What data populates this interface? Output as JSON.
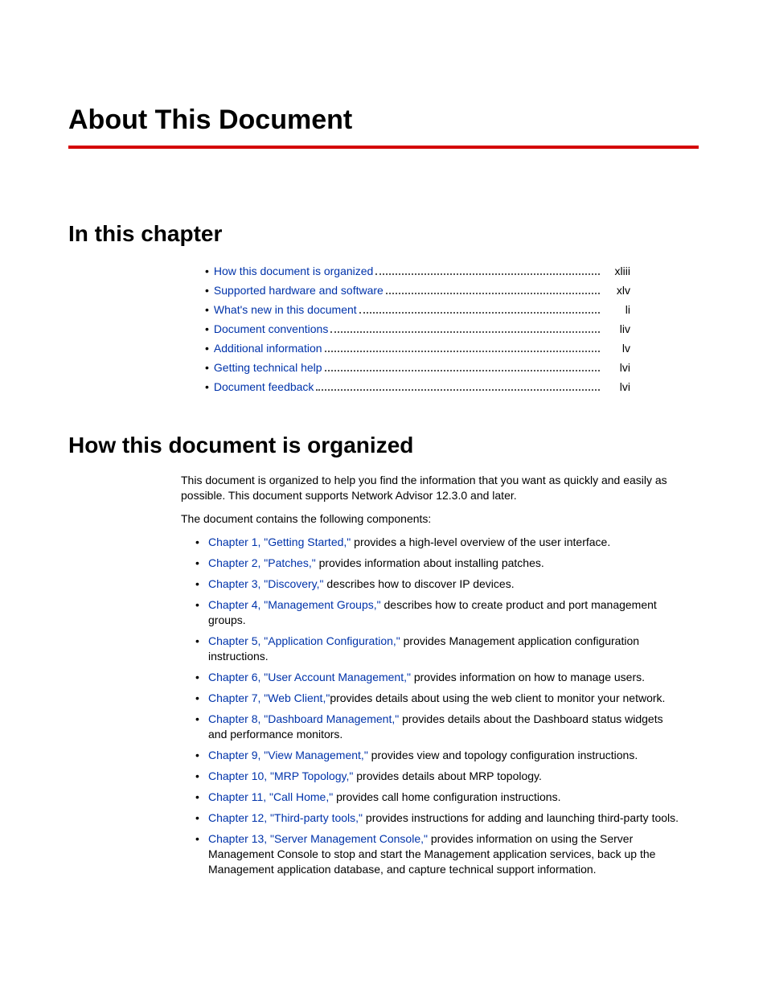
{
  "title": "About This Document",
  "sections": {
    "in_this_chapter": "In this chapter",
    "how_organized": "How this document is organized"
  },
  "toc": [
    {
      "label": "How this document is organized",
      "page": "xliii"
    },
    {
      "label": "Supported hardware and software",
      "page": "xlv"
    },
    {
      "label": "What's new in this document",
      "page": "li"
    },
    {
      "label": "Document conventions",
      "page": "liv"
    },
    {
      "label": "Additional information",
      "page": "lv"
    },
    {
      "label": "Getting technical help",
      "page": "lvi"
    },
    {
      "label": "Document feedback",
      "page": "lvi"
    }
  ],
  "body": {
    "para1": "This document is organized to help you find the information that you want as quickly and easily as possible. This document supports Network Advisor 12.3.0 and later.",
    "para2": "The document contains the following components:"
  },
  "chapters": [
    {
      "link": "Chapter 1, \"Getting Started,\"",
      "text": " provides a high-level overview of the user interface."
    },
    {
      "link": "Chapter 2, \"Patches,\"",
      "text": " provides information about installing patches."
    },
    {
      "link": "Chapter 3, \"Discovery,\"",
      "text": " describes how to discover IP devices."
    },
    {
      "link": "Chapter 4, \"Management Groups,\"",
      "text": " describes how to create product and port management groups."
    },
    {
      "link": "Chapter 5, \"Application Configuration,\"",
      "text": " provides Management application configuration instructions."
    },
    {
      "link": "Chapter 6, \"User Account Management,\"",
      "text": " provides information on how to manage users."
    },
    {
      "link": "Chapter 7, \"Web Client,\"",
      "text": "provides details about using the web client to monitor your network."
    },
    {
      "link": "Chapter 8, \"Dashboard Management,\"",
      "text": " provides details about the Dashboard status widgets and performance monitors."
    },
    {
      "link": "Chapter 9, \"View Management,\"",
      "text": " provides view and topology configuration instructions."
    },
    {
      "link": "Chapter 10, \"MRP Topology,\"",
      "text": " provides details about MRP topology."
    },
    {
      "link": "Chapter 11, \"Call Home,\"",
      "text": " provides call home configuration instructions."
    },
    {
      "link": "Chapter 12, \"Third-party tools,\"",
      "text": " provides instructions for adding and launching third-party tools."
    },
    {
      "link": "Chapter 13, \"Server Management Console,\"",
      "text": " provides information on using the Server Management Console to stop and start the Management application services, back up the Management application database, and capture technical support information."
    }
  ]
}
